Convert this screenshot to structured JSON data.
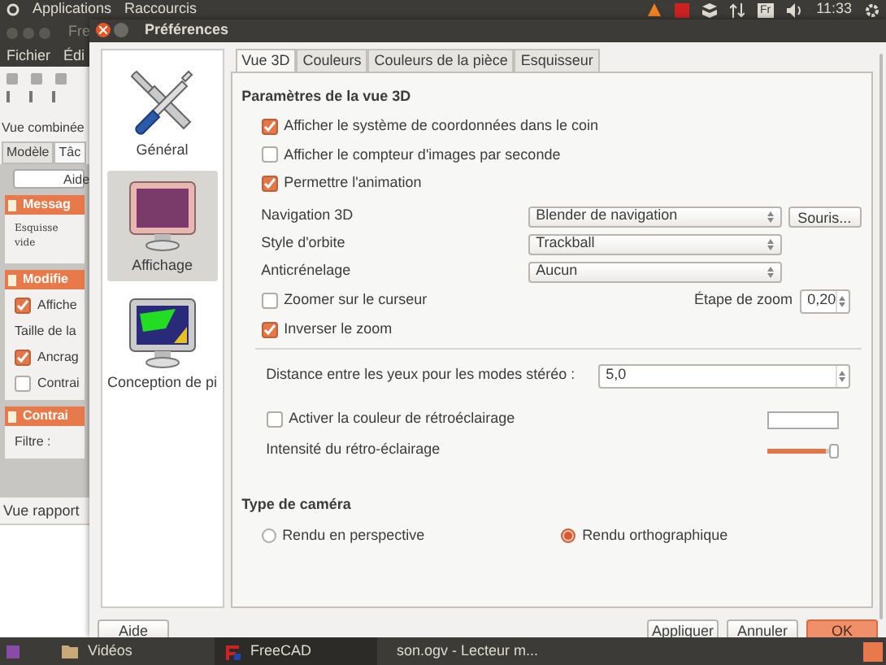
{
  "top_panel": {
    "menus": [
      "Applications",
      "Raccourcis"
    ],
    "keyboard": "Fr",
    "time": "11:33"
  },
  "background_window": {
    "title": "Fre",
    "menus": [
      "Fichier",
      "Édi"
    ],
    "dock_title": "Vue combinée",
    "tabs": [
      {
        "label": "Modèle",
        "selected": false
      },
      {
        "label": "Tâc",
        "selected": true
      }
    ],
    "help_button": "Aide",
    "panels": [
      {
        "title": "Messag",
        "items": [
          {
            "kind": "note",
            "label": "Esquisse vide"
          }
        ]
      },
      {
        "title": "Modifie",
        "items": [
          {
            "kind": "checkbox",
            "label": "Affiche",
            "checked": true
          },
          {
            "kind": "text",
            "label": "Taille de la"
          },
          {
            "kind": "checkbox",
            "label": "Ancrag",
            "checked": true
          },
          {
            "kind": "checkbox",
            "label": "Contrai",
            "checked": false
          }
        ]
      },
      {
        "title": "Contrai",
        "items": [
          {
            "kind": "text",
            "label": "Filtre :"
          }
        ]
      }
    ],
    "report_title": "Vue rapport"
  },
  "dialog": {
    "title": "Préférences",
    "pages": [
      {
        "label": "Général",
        "selected": false
      },
      {
        "label": "Affichage",
        "selected": true
      },
      {
        "label": "Conception de pi",
        "selected": false
      }
    ],
    "tabs": [
      {
        "label": "Vue 3D",
        "selected": true
      },
      {
        "label": "Couleurs",
        "selected": false
      },
      {
        "label": "Couleurs de la pièce",
        "selected": false
      },
      {
        "label": "Esquisseur",
        "selected": false
      }
    ],
    "section_title": "Paramètres de la vue 3D",
    "checkboxes": [
      {
        "label": "Afficher le système de coordonnées dans le coin",
        "checked": true
      },
      {
        "label": "Afficher le compteur d'images par seconde",
        "checked": false
      },
      {
        "label": "Permettre l'animation",
        "checked": true
      }
    ],
    "navigation": {
      "label": "Navigation 3D",
      "value": "Blender de navigation",
      "button": "Souris..."
    },
    "orbit": {
      "label": "Style d'orbite",
      "value": "Trackball"
    },
    "antialiasing": {
      "label": "Anticrénelage",
      "value": "Aucun"
    },
    "zoom_cursor": {
      "label": "Zoomer sur le curseur",
      "checked": false
    },
    "zoom_step": {
      "label": "Étape de zoom",
      "value": "0,20"
    },
    "invert_zoom": {
      "label": "Inverser le zoom",
      "checked": true
    },
    "stereo": {
      "label": "Distance entre les yeux pour les modes stéréo :",
      "value": "5,0"
    },
    "backlight": {
      "label": "Activer la couleur de rétroéclairage",
      "checked": false
    },
    "intensity": {
      "label": "Intensité du rétro-éclairage",
      "level": 0.95
    },
    "camera": {
      "title": "Type de caméra",
      "options": [
        {
          "label": "Rendu en perspective",
          "selected": false
        },
        {
          "label": "Rendu orthographique",
          "selected": true
        }
      ]
    },
    "buttons": {
      "help": "Aide",
      "apply": "Appliquer",
      "cancel": "Annuler",
      "ok": "OK"
    }
  },
  "taskbar": [
    {
      "label": "Vidéos",
      "active": false
    },
    {
      "label": "FreeCAD",
      "active": true
    },
    {
      "label": "son.ogv - Lecteur m...",
      "active": false
    }
  ]
}
